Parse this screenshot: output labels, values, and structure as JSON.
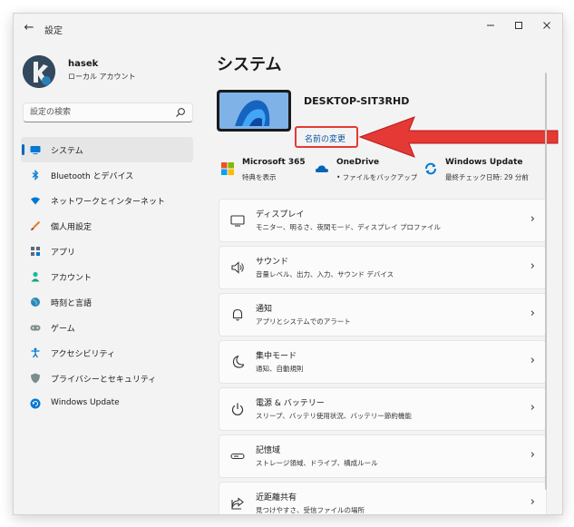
{
  "window": {
    "title": "設定",
    "back_icon": "arrow-left-icon"
  },
  "user": {
    "name": "hasek",
    "account_type": "ローカル アカウント"
  },
  "search": {
    "placeholder": "設定の検索"
  },
  "sidebar": {
    "items": [
      {
        "label": "システム",
        "icon": "monitor-icon",
        "selected": true
      },
      {
        "label": "Bluetooth とデバイス",
        "icon": "bluetooth-icon"
      },
      {
        "label": "ネットワークとインターネット",
        "icon": "wifi-icon"
      },
      {
        "label": "個人用設定",
        "icon": "brush-icon"
      },
      {
        "label": "アプリ",
        "icon": "apps-icon"
      },
      {
        "label": "アカウント",
        "icon": "person-icon"
      },
      {
        "label": "時刻と言語",
        "icon": "globe-clock-icon"
      },
      {
        "label": "ゲーム",
        "icon": "gamepad-icon"
      },
      {
        "label": "アクセシビリティ",
        "icon": "accessibility-icon"
      },
      {
        "label": "プライバシーとセキュリティ",
        "icon": "shield-icon"
      },
      {
        "label": "Windows Update",
        "icon": "update-icon"
      }
    ]
  },
  "main": {
    "title": "システム",
    "device": {
      "name": "DESKTOP-SIT3RHD",
      "rename_label": "名前の変更"
    },
    "quick": [
      {
        "title": "Microsoft 365",
        "subtitle": "特典を表示",
        "icon": "microsoft-logo-icon"
      },
      {
        "title": "OneDrive",
        "subtitle": "• ファイルをバックアップ",
        "icon": "cloud-icon"
      },
      {
        "title": "Windows Update",
        "subtitle": "最終チェック日時: 29 分前",
        "icon": "update-icon"
      }
    ],
    "cards": [
      {
        "title": "ディスプレイ",
        "subtitle": "モニター、明るさ、夜間モード、ディスプレイ プロファイル",
        "icon": "display-icon"
      },
      {
        "title": "サウンド",
        "subtitle": "音量レベル、出力、入力、サウンド デバイス",
        "icon": "speaker-icon"
      },
      {
        "title": "通知",
        "subtitle": "アプリとシステムでのアラート",
        "icon": "bell-icon"
      },
      {
        "title": "集中モード",
        "subtitle": "通知、自動規則",
        "icon": "moon-icon"
      },
      {
        "title": "電源 & バッテリー",
        "subtitle": "スリープ、バッテリ使用状況、バッテリー節約機能",
        "icon": "power-icon"
      },
      {
        "title": "記憶域",
        "subtitle": "ストレージ領域、ドライブ、構成ルール",
        "icon": "storage-icon"
      },
      {
        "title": "近距離共有",
        "subtitle": "見つけやすさ、受信ファイルの場所",
        "icon": "share-icon"
      }
    ]
  },
  "colors": {
    "accent": "#0067c0",
    "highlight": "#e53935",
    "link": "#0b57a3"
  }
}
